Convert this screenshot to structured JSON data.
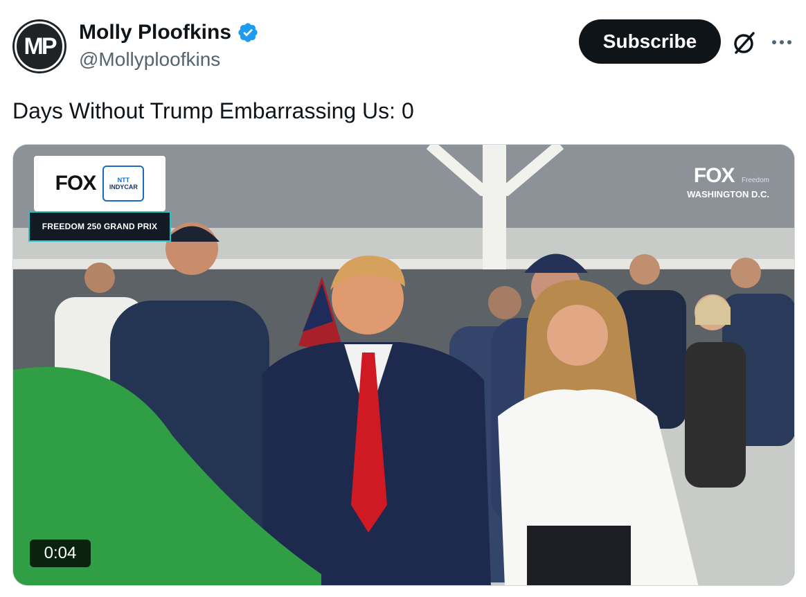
{
  "author": {
    "name": "Molly Ploofkins",
    "handle": "@Mollyploofkins",
    "avatar_initials": "MP",
    "verified": true,
    "verified_icon": "verified-badge-icon"
  },
  "actions": {
    "subscribe_label": "Subscribe",
    "grok_icon": "grok-icon",
    "more_icon": "more-options-icon"
  },
  "tweet": {
    "text": "Days Without Trump Embarrassing Us: 0"
  },
  "media": {
    "type": "video",
    "duration": "0:04",
    "broadcast_logo": "FOX",
    "series_logo_top": "NTT",
    "series_logo_main": "INDYCAR",
    "race_name": "FREEDOM 250 GRAND PRIX",
    "network_logo": "FOX",
    "network_sublogo": "Freedom",
    "network_city": "WASHINGTON D.C."
  },
  "colors": {
    "accent": "#1d9bf0",
    "text_primary": "#0f1419",
    "text_secondary": "#536471",
    "button_bg": "#0f1419"
  }
}
